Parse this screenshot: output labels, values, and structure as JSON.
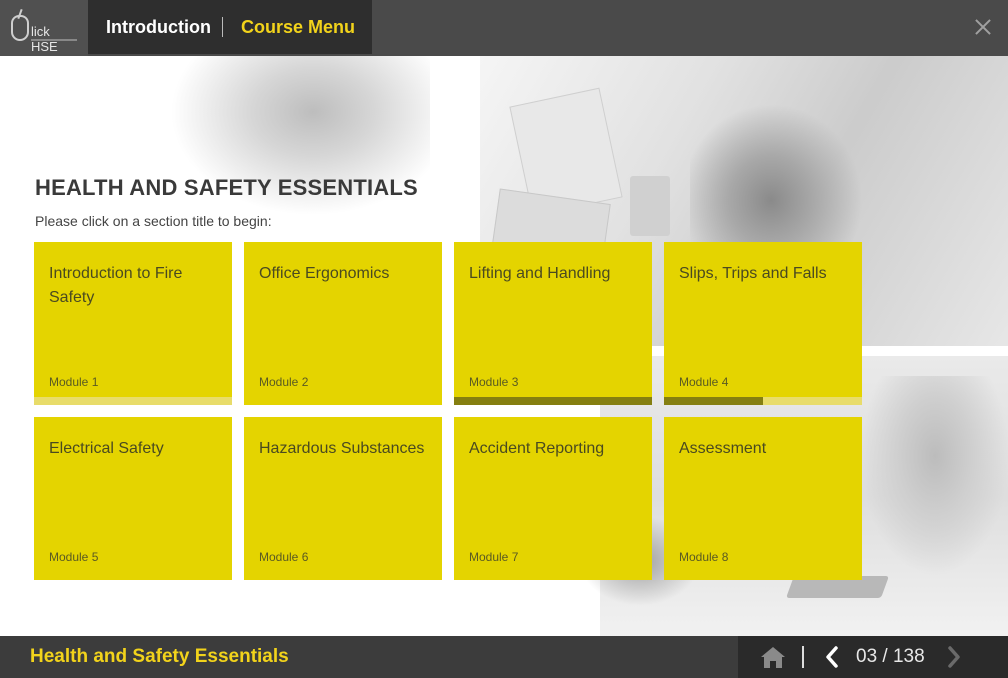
{
  "header": {
    "logo_text": "lick HSE",
    "tabs": [
      {
        "label": "Introduction",
        "active": false
      },
      {
        "label": "Course Menu",
        "active": true
      }
    ],
    "accent_color": "#f2d31b"
  },
  "main": {
    "title": "HEALTH AND SAFETY ESSENTIALS",
    "subtitle": "Please click on a section title to begin:",
    "tile_color": "#e4d400",
    "modules": [
      {
        "title": "Introduction to Fire Safety",
        "module": "Module 1",
        "progress": 0.0
      },
      {
        "title": "Office Ergonomics",
        "module": "Module 2",
        "progress": 0.0
      },
      {
        "title": "Lifting and Handling",
        "module": "Module 3",
        "progress": 1.0
      },
      {
        "title": "Slips, Trips and Falls",
        "module": "Module 4",
        "progress": 0.5
      },
      {
        "title": "Electrical Safety",
        "module": "Module 5"
      },
      {
        "title": "Hazardous Substances",
        "module": "Module 6"
      },
      {
        "title": "Accident Reporting",
        "module": "Module 7"
      },
      {
        "title": "Assessment",
        "module": "Module 8"
      }
    ]
  },
  "footer": {
    "course_title": "Health and Safety Essentials",
    "page_indicator": "03 / 138",
    "icons": [
      "home-icon",
      "chevron-left-icon",
      "chevron-right-icon"
    ]
  }
}
